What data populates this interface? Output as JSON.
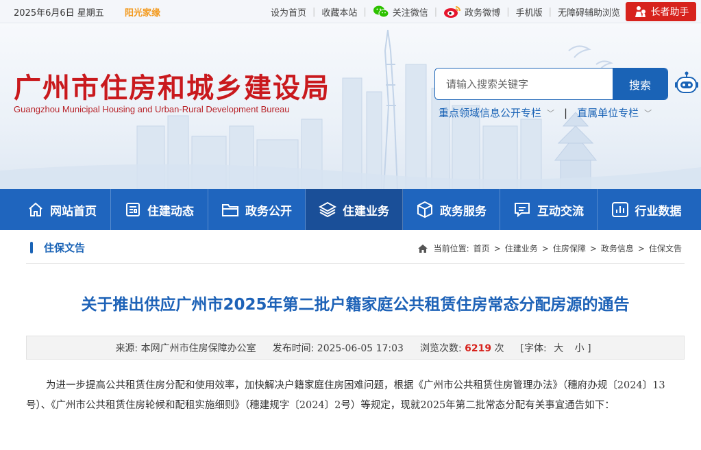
{
  "topbar": {
    "date": "2025年6月6日 星期五",
    "sunny_home": "阳光家缘",
    "links": [
      "设为首页",
      "收藏本站",
      "关注微信",
      "政务微博",
      "手机版",
      "无障碍辅助浏览"
    ],
    "elder_button": "长者助手",
    "colors": {
      "accent_red": "#d7231d",
      "sunny_orange": "#f39a1e"
    }
  },
  "header": {
    "title": "广州市住房和城乡建设局",
    "subtitle": "Guangzhou Municipal Housing and Urban-Rural Development Bureau",
    "search_placeholder": "请输入搜索关键字",
    "search_button": "搜索",
    "column_links": [
      "重点领域信息公开专栏",
      "直属单位专栏"
    ],
    "colors": {
      "title_red": "#c9191d",
      "brand_blue": "#1a63b6"
    }
  },
  "nav": {
    "items": [
      {
        "label": "网站首页",
        "icon": "home-icon"
      },
      {
        "label": "住建动态",
        "icon": "news-icon"
      },
      {
        "label": "政务公开",
        "icon": "folder-icon"
      },
      {
        "label": "住建业务",
        "icon": "layers-icon",
        "active": true
      },
      {
        "label": "政务服务",
        "icon": "cube-icon"
      },
      {
        "label": "互动交流",
        "icon": "chat-icon"
      },
      {
        "label": "行业数据",
        "icon": "bar-chart-icon"
      }
    ],
    "color": "#1f65be"
  },
  "section": {
    "title": "住保文告",
    "breadcrumb_prefix": "当前位置:",
    "breadcrumb": [
      "首页",
      "住建业务",
      "住房保障",
      "政务信息",
      "住保文告"
    ]
  },
  "article": {
    "title": "关于推出供应广州市2025年第二批户籍家庭公共租赁住房常态分配房源的通告",
    "meta": {
      "source_label": "来源:",
      "source": "本网广州市住房保障办公室",
      "time_label": "发布时间:",
      "time": "2025-06-05 17:03",
      "views_label": "浏览次数:",
      "views": "6219",
      "views_unit": "次",
      "font_label": "[字体:",
      "font_large": "大",
      "font_small": "小 ]"
    },
    "paragraph": "为进一步提高公共租赁住房分配和使用效率，加快解决户籍家庭住房困难问题，根据《广州市公共租赁住房管理办法》（穗府办规〔2024〕13号）、《广州市公共租赁住房轮候和配租实施细则》（穗建规字〔2024〕2号）等规定，现就2025年第二批常态分配有关事宜通告如下："
  }
}
